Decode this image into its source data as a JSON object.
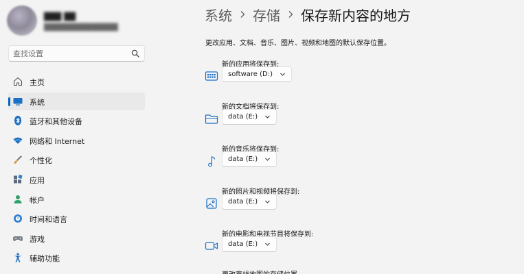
{
  "breadcrumb": {
    "items": [
      "系统",
      "存储",
      "保存新内容的地方"
    ]
  },
  "sidebar": {
    "search_placeholder": "查找设置",
    "items": [
      {
        "label": "主页",
        "icon": "home-icon"
      },
      {
        "label": "系统",
        "icon": "system-icon",
        "active": true
      },
      {
        "label": "蓝牙和其他设备",
        "icon": "bluetooth-icon"
      },
      {
        "label": "网络和 Internet",
        "icon": "wifi-icon"
      },
      {
        "label": "个性化",
        "icon": "brush-icon"
      },
      {
        "label": "应用",
        "icon": "apps-icon"
      },
      {
        "label": "帐户",
        "icon": "account-icon"
      },
      {
        "label": "时间和语言",
        "icon": "globe-icon"
      },
      {
        "label": "游戏",
        "icon": "gamepad-icon"
      },
      {
        "label": "辅助功能",
        "icon": "accessibility-icon"
      }
    ]
  },
  "main": {
    "description": "更改应用、文档、音乐、图片、视频和地图的默认保存位置。",
    "settings": [
      {
        "label": "新的应用将保存到:",
        "value": "software (D:)",
        "icon": "apps-save-icon"
      },
      {
        "label": "新的文档将保存到:",
        "value": "data (E:)",
        "icon": "folder-icon"
      },
      {
        "label": "新的音乐将保存到:",
        "value": "data (E:)",
        "icon": "music-note-icon"
      },
      {
        "label": "新的照片和视频将保存到:",
        "value": "data (E:)",
        "icon": "photo-icon"
      },
      {
        "label": "新的电影和电视节目将保存到:",
        "value": "data (E:)",
        "icon": "video-camera-icon"
      }
    ],
    "cut_off_label": "更改离线地图的存储位置"
  },
  "colors": {
    "accent": "#0067c0",
    "background": "#f3f3f3"
  }
}
